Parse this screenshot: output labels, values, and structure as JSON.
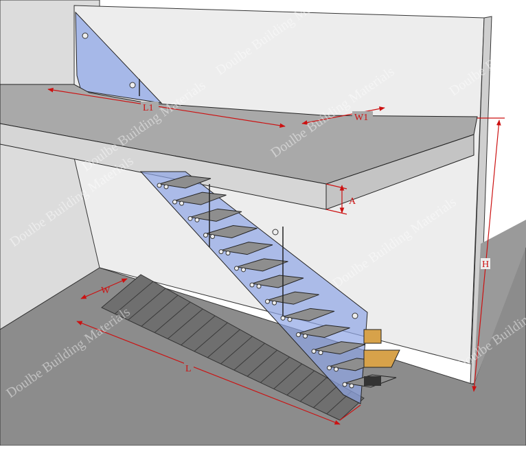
{
  "dimension_labels": {
    "l1": "L1",
    "w1": "W1",
    "a": "A",
    "h": "H",
    "w": "W",
    "l": "L"
  },
  "watermark": "Doulbe Building Materials",
  "colors": {
    "dimension": "#cc1111",
    "glass": "#8ea5e6",
    "tread": "#8e8e8e",
    "wood": "#d7a24a",
    "wall": "#ececec",
    "floor": "#8c8c8c",
    "slab_top": "#a9a9a9"
  },
  "stair": {
    "tread_count": 13
  }
}
